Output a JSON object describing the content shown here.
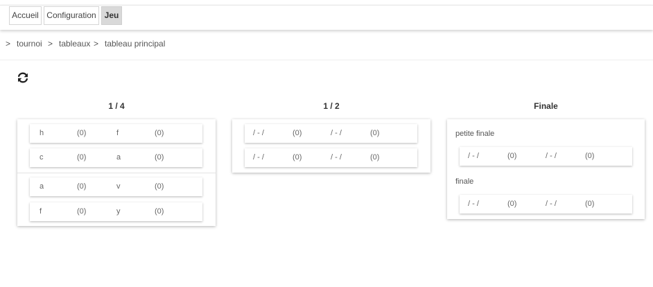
{
  "nav": {
    "home": "Accueil",
    "config": "Configuration",
    "game": "Jeu"
  },
  "breadcrumb": {
    "sep": ">",
    "item1": "tournoi",
    "item2": "tableaux",
    "item3": "tableau principal"
  },
  "columns": {
    "quarter": {
      "title": "1 / 4",
      "matches": [
        {
          "p1": "h",
          "s1": "(0)",
          "p2": "f",
          "s2": "(0)"
        },
        {
          "p1": "c",
          "s1": "(0)",
          "p2": "a",
          "s2": "(0)"
        },
        {
          "p1": "a",
          "s1": "(0)",
          "p2": "v",
          "s2": "(0)"
        },
        {
          "p1": "f",
          "s1": "(0)",
          "p2": "y",
          "s2": "(0)"
        }
      ]
    },
    "semi": {
      "title": "1 / 2",
      "matches": [
        {
          "p1": "/ - /",
          "s1": "(0)",
          "p2": "/ - /",
          "s2": "(0)"
        },
        {
          "p1": "/ - /",
          "s1": "(0)",
          "p2": "/ - /",
          "s2": "(0)"
        }
      ]
    },
    "final": {
      "title": "Finale",
      "small_final_label": "petite finale",
      "final_label": "finale",
      "matches": [
        {
          "p1": "/ - /",
          "s1": "(0)",
          "p2": "/ - /",
          "s2": "(0)"
        },
        {
          "p1": "/ - /",
          "s1": "(0)",
          "p2": "/ - /",
          "s2": "(0)"
        }
      ]
    }
  },
  "icons": {
    "refresh": "refresh-icon"
  }
}
